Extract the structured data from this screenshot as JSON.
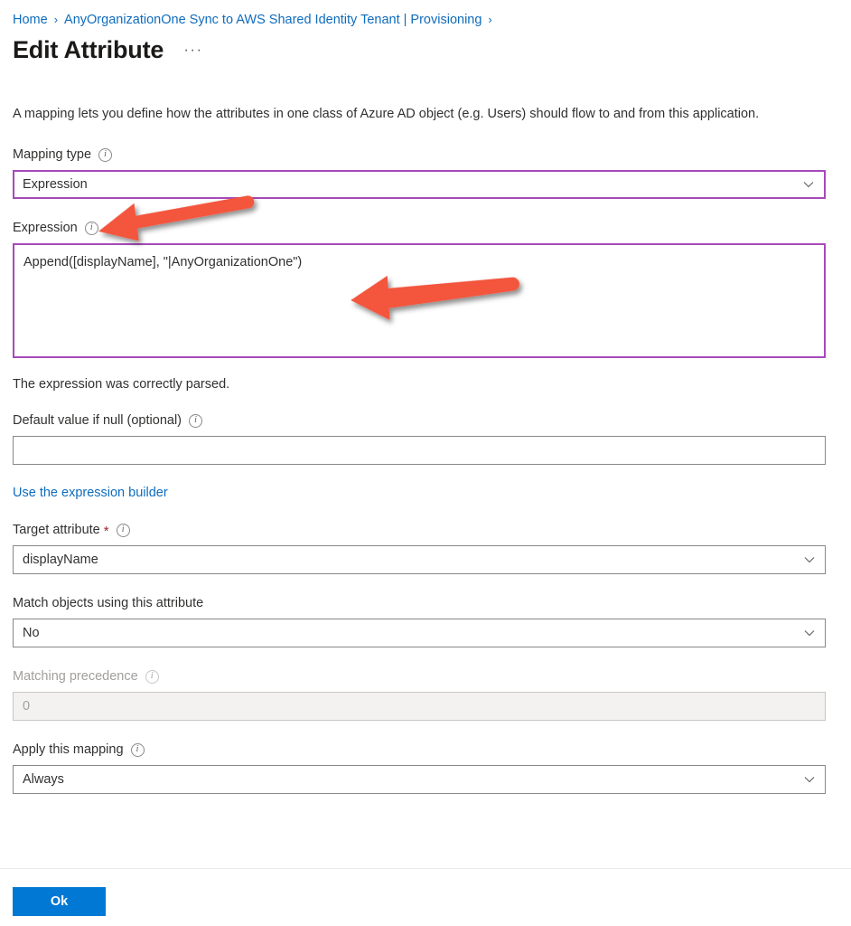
{
  "breadcrumb": {
    "items": [
      {
        "label": "Home"
      },
      {
        "label": "AnyOrganizationOne Sync to AWS Shared Identity Tenant | Provisioning"
      }
    ],
    "separator": "›"
  },
  "header": {
    "title": "Edit Attribute",
    "more_actions": "···"
  },
  "main": {
    "description": "A mapping lets you define how the attributes in one class of Azure AD object (e.g. Users) should flow to and from this application.",
    "fields": {
      "mapping_type": {
        "label": "Mapping type",
        "value": "Expression",
        "info": "ⓘ"
      },
      "expression": {
        "label": "Expression",
        "value": "Append([displayName], \"|AnyOrganizationOne\")"
      },
      "parse_status": "The expression was correctly parsed.",
      "default_value": {
        "label": "Default value if null (optional)",
        "value": "",
        "placeholder": ""
      },
      "expression_builder_link": "Use the expression builder",
      "target_attribute": {
        "label": "Target attribute",
        "required_marker": "*",
        "value": "displayName"
      },
      "match_objects": {
        "label": "Match objects using this attribute",
        "value": "No"
      },
      "matching_precedence": {
        "label": "Matching precedence",
        "value": "0",
        "disabled": true
      },
      "apply_mapping": {
        "label": "Apply this mapping",
        "value": "Always"
      }
    }
  },
  "footer": {
    "ok_label": "Ok"
  },
  "colors": {
    "link": "#0f6cbd",
    "focus_border": "#a64ab8",
    "primary_button": "#0078d4",
    "annotation_arrow": "#f3553d",
    "required_star": "#a4262c",
    "disabled_bg": "#f3f2f1"
  },
  "annotations": [
    {
      "name": "arrow-pointing-to-mapping-type",
      "direction": "left"
    },
    {
      "name": "arrow-pointing-to-expression",
      "direction": "left"
    }
  ]
}
